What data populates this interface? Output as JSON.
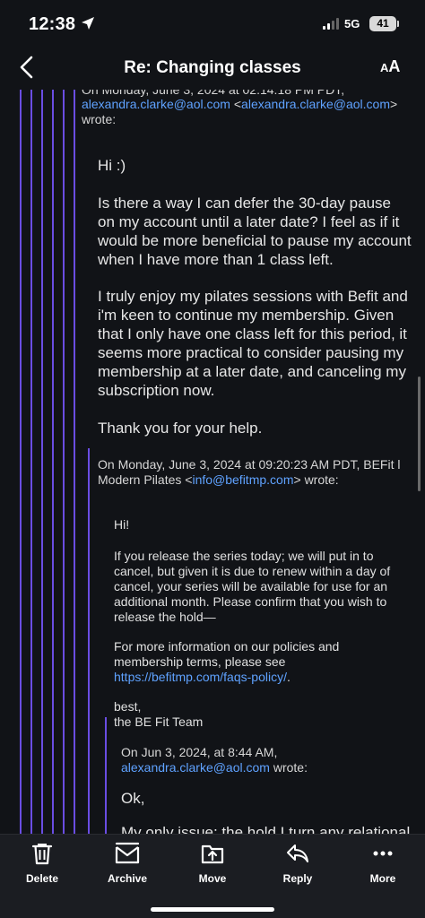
{
  "status": {
    "time": "12:38",
    "network": "5G",
    "battery": "41"
  },
  "nav": {
    "title": "Re: Changing classes",
    "text_size_small": "A",
    "text_size_large": "A"
  },
  "thread": {
    "partial_header": "On Monday, June 3, 2024 at 02:14:18 PM PDT,",
    "sender_email": "alexandra.clarke@aol.com",
    "sender_email_bracket": "alexandra.clarke@aol.com",
    "wrote": "wrote:",
    "message1": {
      "greeting": "Hi :)",
      "para1": "Is there a way I can defer the 30-day pause on my account until a later date? I feel as if it would be more beneficial to pause my account when I have more than 1 class left.",
      "para2": "I truly enjoy my pilates sessions with Befit and i'm keen to continue my membership. Given that I only have one class left for this period, it seems more practical to consider pausing my membership at a later date, and canceling my subscription now.",
      "thanks": "Thank you for your help."
    },
    "quote2_header_line1": "On Monday, June 3, 2024 at 09:20:23 AM PDT, BEFit l",
    "quote2_header_line2_prefix": "Modern Pilates <",
    "quote2_email": "info@befitmp.com",
    "quote2_header_line2_suffix": "> wrote:",
    "message2": {
      "greeting": "Hi!",
      "para1": "If you release the series today; we will put in to cancel,  but given it is due to renew within a day of cancel, your series will be available for use for an additional month.  Please confirm that you wish to release the hold—",
      "para2_prefix": "For more information on our policies and membership terms, please see ",
      "para2_link": "https://befitmp.com/faqs-policy/",
      "para2_suffix": ".",
      "signoff": "best,",
      "team": "the BE Fit Team"
    },
    "quote3_header_line1": "On Jun 3, 2024, at 8:44 AM,",
    "quote3_email": "alexandra.clarke@aol.com",
    "quote3_wrote": "wrote:",
    "message3": {
      "greeting": "Ok,",
      "partial": "My only issue; the hold I turn any relational"
    }
  },
  "toolbar": {
    "delete": "Delete",
    "archive": "Archive",
    "move": "Move",
    "reply": "Reply",
    "more": "More"
  },
  "colors": {
    "quote_line": "#6a4de3",
    "link": "#5fa2ff",
    "background": "#111317"
  }
}
